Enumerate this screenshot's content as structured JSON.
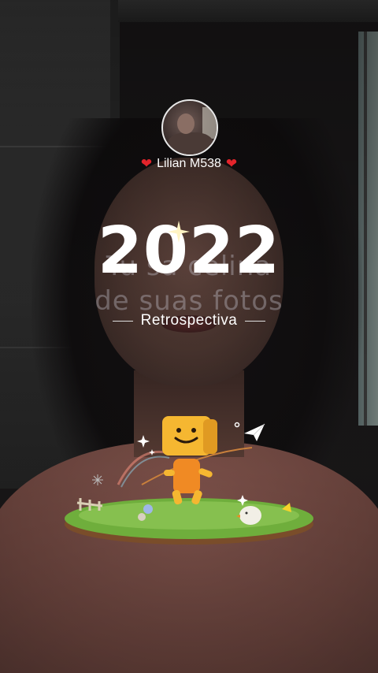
{
  "profile": {
    "username": "Lilian M538",
    "avatar_alt": "profile photo"
  },
  "overlay": {
    "year": "2022",
    "subtitle": "Retrospectiva",
    "background_caption_line1": "Tu sa celina",
    "background_caption_line2": "de suas fotos"
  },
  "icons": {
    "heart": "heart-icon",
    "sparkle": "sparkle-icon",
    "paper_plane": "paper-plane-icon"
  },
  "colors": {
    "heart": "#e3242b",
    "mascot_head": "#f5b731",
    "mascot_body": "#f08a24",
    "grass": "#6fae3c"
  }
}
